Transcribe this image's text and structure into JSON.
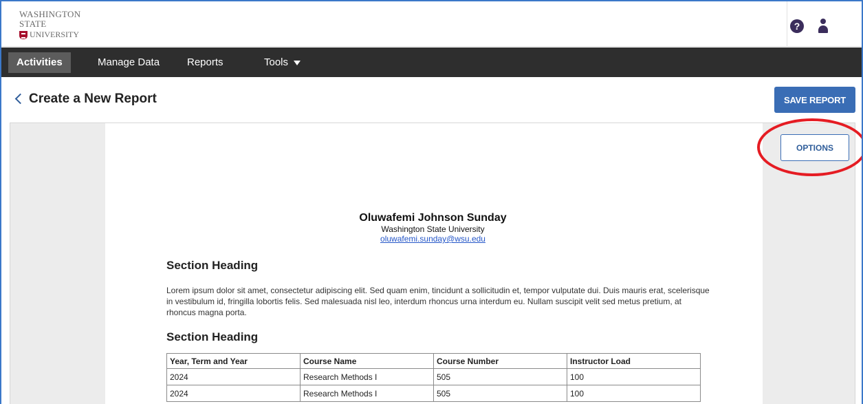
{
  "header": {
    "logo_line1": "Washington State",
    "logo_line2": "University",
    "help_icon": "question-circle-icon",
    "user_icon": "user-icon"
  },
  "nav": {
    "items": [
      {
        "label": "Activities",
        "active": true
      },
      {
        "label": "Manage Data"
      },
      {
        "label": "Reports"
      },
      {
        "label": "Tools"
      }
    ]
  },
  "page": {
    "title": "Create a New Report",
    "back_icon": "chevron-left-icon",
    "save_label": "SAVE REPORT",
    "options_label": "OPTIONS"
  },
  "report": {
    "name": "Oluwafemi Johnson Sunday",
    "institution": "Washington State University",
    "email": "oluwafemi.sunday@wsu.edu",
    "section1_heading": "Section Heading",
    "section1_text": "Lorem ipsum dolor sit amet, consectetur adipiscing elit. Sed quam enim, tincidunt a sollicitudin et, tempor vulputate dui. Duis mauris erat, scelerisque in vestibulum id, fringilla lobortis felis. Sed malesuada nisl leo, interdum rhoncus urna interdum eu. Nullam suscipit velit sed metus pretium, at rhoncus magna porta.",
    "section2_heading": "Section Heading",
    "table": {
      "headers": [
        "Year, Term and Year",
        "Course Name",
        "Course Number",
        "Instructor Load"
      ],
      "rows": [
        [
          "2024",
          "Research Methods I",
          "505",
          "100"
        ],
        [
          "2024",
          "Research Methods I",
          "505",
          "100"
        ]
      ]
    }
  },
  "colors": {
    "accent": "#3a6db5",
    "nav_bg": "#2e2e2e",
    "highlight": "#e51c23"
  }
}
